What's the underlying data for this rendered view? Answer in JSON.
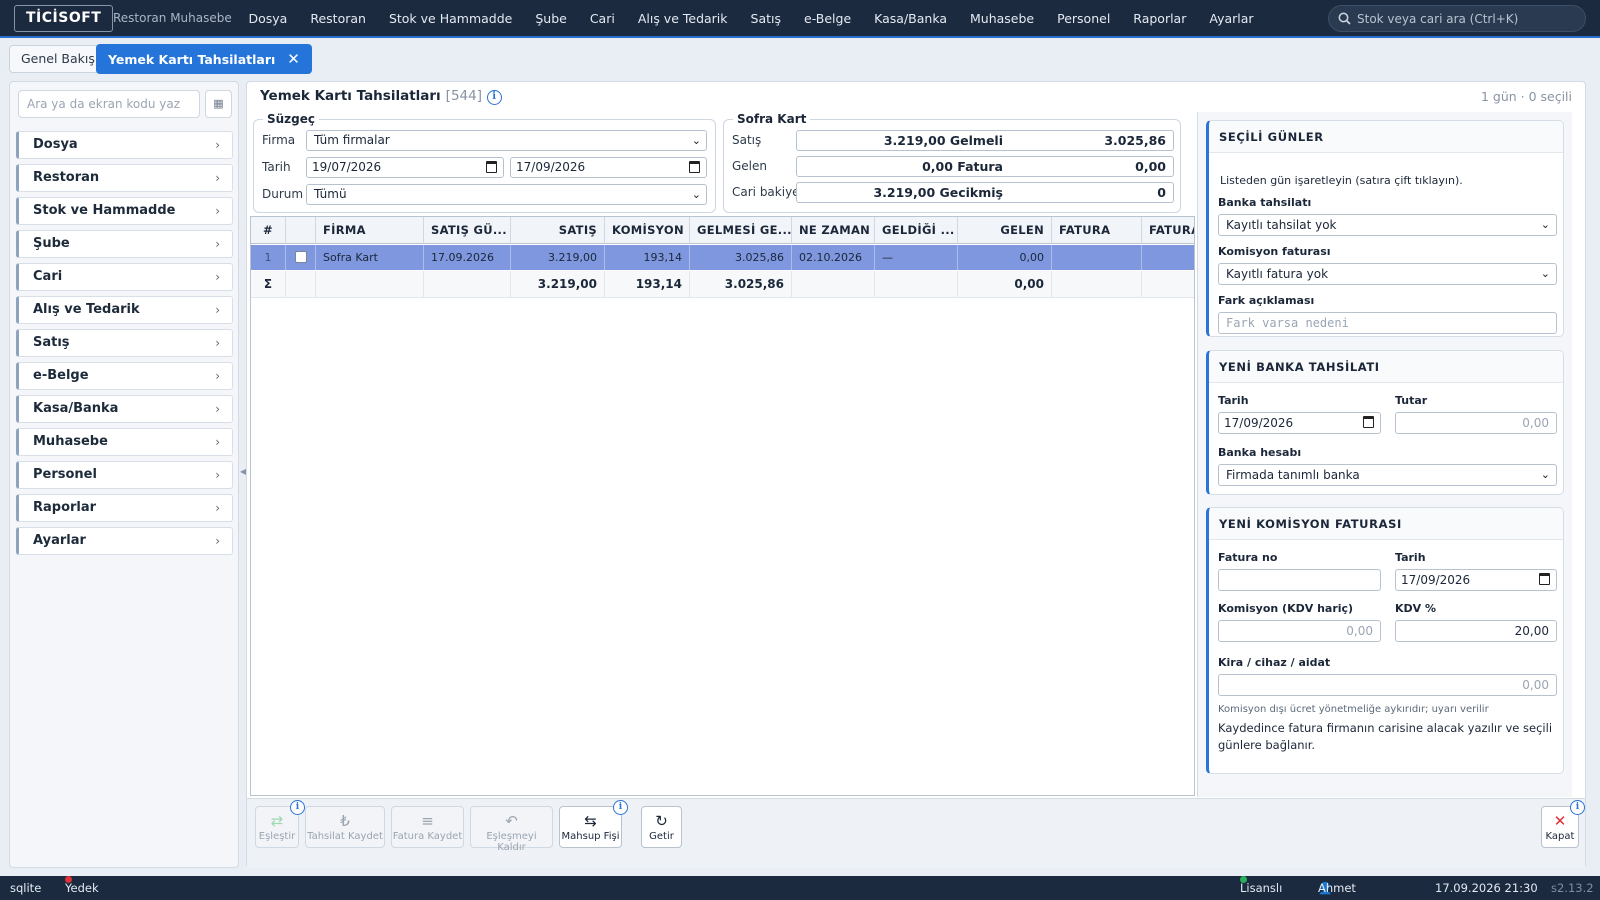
{
  "app": {
    "logo": "TİCİSOFT",
    "name": "Restoran Muhasebe"
  },
  "menu": [
    "Dosya",
    "Restoran",
    "Stok ve Hammadde",
    "Şube",
    "Cari",
    "Alış ve Tedarik",
    "Satış",
    "e-Belge",
    "Kasa/Banka",
    "Muhasebe",
    "Personel",
    "Raporlar",
    "Ayarlar"
  ],
  "search": {
    "placeholder": "Stok veya cari ara (Ctrl+K)"
  },
  "tabs": {
    "overview": "Genel Bakış",
    "active": "Yemek Kartı Tahsilatları",
    "close": "✕"
  },
  "sidebar": {
    "search_placeholder": "Ara ya da ekran kodu yaz",
    "items": [
      "Dosya",
      "Restoran",
      "Stok ve Hammadde",
      "Şube",
      "Cari",
      "Alış ve Tedarik",
      "Satış",
      "e-Belge",
      "Kasa/Banka",
      "Muhasebe",
      "Personel",
      "Raporlar",
      "Ayarlar"
    ]
  },
  "page": {
    "title": "Yemek Kartı Tahsilatları",
    "code": "[544]",
    "status": "1 gün · 0 seçili"
  },
  "filter": {
    "legend": "Süzgeç",
    "firma_label": "Firma",
    "firma_value": "Tüm firmalar",
    "tarih_label": "Tarih",
    "date_from": "19/07/2026",
    "date_to": "17/09/2026",
    "durum_label": "Durum",
    "durum_value": "Tümü"
  },
  "sofra": {
    "legend": "Sofra Kart",
    "satis_label": "Satış",
    "satis_a": "3.219,00 Gelmeli",
    "satis_b": "3.025,86",
    "gelen_label": "Gelen",
    "gelen_a": "0,00 Fatura",
    "gelen_b": "0,00",
    "cari_label": "Cari bakiye",
    "cari_a": "3.219,00 Gecikmiş",
    "cari_b": "0"
  },
  "grid": {
    "headers": [
      "#",
      "",
      "FİRMA",
      "SATIŞ GÜ...",
      "SATIŞ",
      "KOMİSYON",
      "GELMESİ GE...",
      "NE ZAMAN",
      "GELDİĞİ ...",
      "GELEN",
      "FATURA",
      "FATURA"
    ],
    "row": {
      "no": "1",
      "firma": "Sofra Kart",
      "satis_gunu": "17.09.2026",
      "satis": "3.219,00",
      "komisyon": "193,14",
      "gelmesi_gereken": "3.025,86",
      "ne_zaman": "02.10.2026",
      "geldigi": "—",
      "gelen": "0,00"
    },
    "sum": {
      "sym": "Σ",
      "satis": "3.219,00",
      "komisyon": "193,14",
      "gelmesi_gereken": "3.025,86",
      "gelen": "0,00"
    }
  },
  "secili": {
    "title": "SEÇİLİ GÜNLER",
    "hint": "Listeden gün işaretleyin (satıra çift tıklayın).",
    "banka_label": "Banka tahsilatı",
    "banka_value": "Kayıtlı tahsilat yok",
    "komfat_label": "Komisyon faturası",
    "komfat_value": "Kayıtlı fatura yok",
    "fark_label": "Fark açıklaması",
    "fark_placeholder": "Fark varsa nedeni"
  },
  "yenibanka": {
    "title": "YENİ BANKA TAHSİLATI",
    "tarih_label": "Tarih",
    "tarih_value": "17/09/2026",
    "tutar_label": "Tutar",
    "tutar_placeholder": "0,00",
    "hesap_label": "Banka hesabı",
    "hesap_value": "Firmada tanımlı banka"
  },
  "yenikom": {
    "title": "YENİ KOMİSYON FATURASI",
    "faturano_label": "Fatura no",
    "tarih_label": "Tarih",
    "tarih_value": "17/09/2026",
    "komisyon_label": "Komisyon (KDV hariç)",
    "komisyon_placeholder": "0,00",
    "kdv_label": "KDV %",
    "kdv_value": "20,00",
    "kira_label": "Kira / cihaz / aidat",
    "kira_placeholder": "0,00",
    "kira_note": "Komisyon dışı ücret yönetmeliğe aykırıdır; uyarı verilir",
    "info_note": "Kaydedince fatura firmanın carisine alacak yazılır ve seçili günlere bağlanır."
  },
  "toolbar": {
    "eslestir": "Eşleştir",
    "tahsilat": "Tahsilat Kaydet",
    "fatura": "Fatura Kaydet",
    "eslesme_kaldir": "Eşleşmeyi Kaldır",
    "mahsup": "Mahsup Fişi",
    "getir": "Getir",
    "kapat": "Kapat"
  },
  "statusbar": {
    "db": "sqlite",
    "backup": "Yedek yok",
    "license": "Lisanslı",
    "user": "Ahmet Karaca",
    "datetime": "17.09.2026 21:30",
    "version": "s2.13.2"
  },
  "colors": {
    "accent": "#2474da",
    "topbar": "#1b2a3f",
    "row_selected": "#7e97de",
    "danger": "#e0303a",
    "ok": "#27b05a"
  }
}
